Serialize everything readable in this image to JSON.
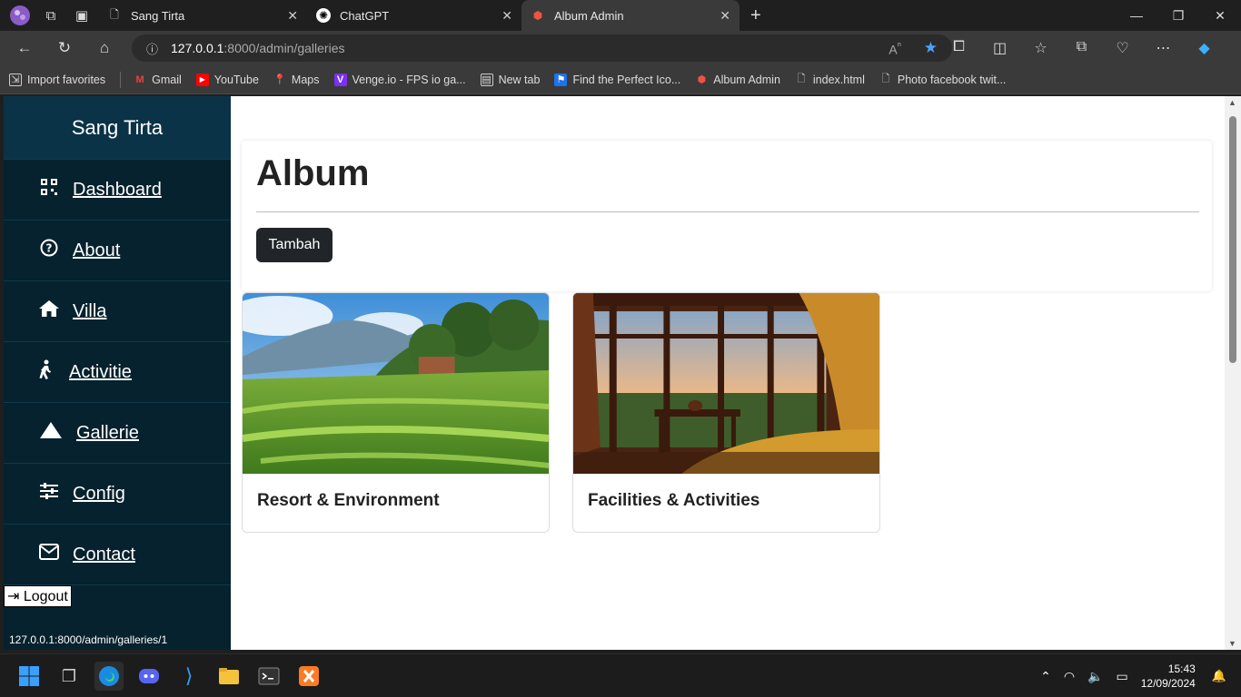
{
  "browser": {
    "tabs": [
      {
        "label": "Sang Tirta",
        "active": false
      },
      {
        "label": "ChatGPT",
        "active": false
      },
      {
        "label": "Album Admin",
        "active": true
      }
    ],
    "url_host": "127.0.0.1",
    "url_path": ":8000/admin/galleries",
    "bookmarks": [
      {
        "label": "Import favorites",
        "icon": "import-icon"
      },
      {
        "label": "Gmail",
        "icon": "gmail-icon"
      },
      {
        "label": "YouTube",
        "icon": "youtube-icon"
      },
      {
        "label": "Maps",
        "icon": "maps-icon"
      },
      {
        "label": "Venge.io - FPS io ga...",
        "icon": "venge-icon"
      },
      {
        "label": "New tab",
        "icon": "newtab-icon"
      },
      {
        "label": "Find the Perfect Ico...",
        "icon": "flag-icon"
      },
      {
        "label": "Album Admin",
        "icon": "laravel-icon"
      },
      {
        "label": "index.html",
        "icon": "file-icon"
      },
      {
        "label": "Photo facebook twit...",
        "icon": "file-icon"
      }
    ],
    "status_url": "127.0.0.1:8000/admin/galleries/1"
  },
  "sidebar": {
    "brand": "Sang Tirta",
    "items": [
      {
        "label": "Dashboard",
        "icon": "qrcode-icon"
      },
      {
        "label": "About",
        "icon": "question-circle-icon"
      },
      {
        "label": "Villa",
        "icon": "home-icon"
      },
      {
        "label": "Activitie",
        "icon": "walking-icon"
      },
      {
        "label": "Gallerie",
        "icon": "mountain-icon"
      },
      {
        "label": "Config",
        "icon": "sliders-icon"
      },
      {
        "label": "Contact",
        "icon": "envelope-icon"
      }
    ],
    "logout": "Logout"
  },
  "main": {
    "title": "Album",
    "add_button": "Tambah",
    "albums": [
      {
        "title": "Resort & Environment",
        "image": "rice-terrace-photo"
      },
      {
        "title": "Facilities & Activities",
        "image": "villa-bedroom-photo"
      }
    ]
  },
  "taskbar": {
    "time": "15:43",
    "date": "12/09/2024"
  },
  "colors": {
    "sidebar_bg": "#06222e",
    "brand_bg": "#0b3347",
    "button_bg": "#212529"
  }
}
